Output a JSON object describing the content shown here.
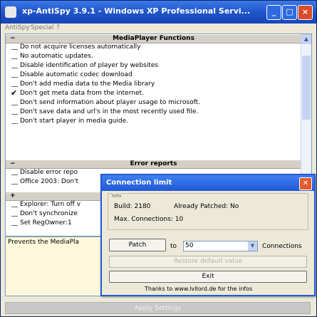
{
  "window": {
    "title": "xp-AntiSpy 3.9.1 - Windows XP Professional Servi..."
  },
  "menu": [
    "AntiSpy",
    "Special",
    "?"
  ],
  "sections": [
    {
      "header": "MediaPlayer Functions",
      "toggle": "−",
      "items": [
        {
          "label": "Do not acquire licenses automatically",
          "checked": false
        },
        {
          "label": "No automatic updates.",
          "checked": false
        },
        {
          "label": "Disable identification of player by websites",
          "checked": false
        },
        {
          "label": "Disable automatic codec download",
          "checked": false
        },
        {
          "label": "Don't add media data to the Media library",
          "checked": false
        },
        {
          "label": "Don't get meta data from the internet.",
          "checked": true
        },
        {
          "label": "Don't send information about player usage to microsoft.",
          "checked": false
        },
        {
          "label": "Don't save data and url's in the most recently used file.",
          "checked": false
        },
        {
          "label": "Don't start player in media guide.",
          "checked": false
        }
      ]
    },
    {
      "header": "Error reports",
      "toggle": "−",
      "items": [
        {
          "label": "Disable error repo",
          "checked": false
        },
        {
          "label": "Office 2003: Don't",
          "checked": false
        }
      ]
    },
    {
      "header": "",
      "toggle": "+",
      "items": [
        {
          "label": "Explorer: Turn off v",
          "checked": false
        },
        {
          "label": "Don't synchronize",
          "checked": false
        },
        {
          "label": "Set RegOwner:1",
          "checked": false
        }
      ]
    }
  ],
  "description": "Prevents the MediaPla",
  "apply_button": "Apply Settings",
  "dialog": {
    "title": "Connection limit",
    "info_legend": "Info",
    "build": "Build: 2180",
    "already_patched": "Already Patched: No",
    "max_connections": "Max. Connections: 10",
    "patch_button": "Patch",
    "to_label": "to",
    "connections_value": "50",
    "connections_label": "Connections",
    "restore_button": "Restore default value",
    "exit_button": "Exit",
    "thanks": "Thanks to www.lvllord.de for the infos"
  }
}
